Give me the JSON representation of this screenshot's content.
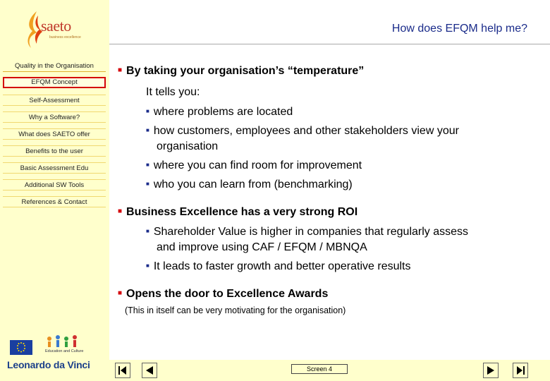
{
  "header": {
    "logo_text": "saeto",
    "logo_sub": "business excellence",
    "title": "How does EFQM help me?"
  },
  "sidebar": {
    "items": [
      {
        "label": "Quality in the Organisation"
      },
      {
        "label": "EFQM Concept"
      },
      {
        "label": "Self-Assessment"
      },
      {
        "label": "Why a Software?"
      },
      {
        "label": "What does SAETO offer"
      },
      {
        "label": "Benefits to the user"
      },
      {
        "label": "Basic Assessment Edu"
      },
      {
        "label": "Additional SW Tools"
      },
      {
        "label": "References & Contact"
      }
    ],
    "edu_logo_text": "Education and Culture",
    "leonardo_text": "Leonardo da Vinci"
  },
  "content": {
    "b1_title": "By taking your organisation’s “temperature”",
    "b1_intro": "It tells you:",
    "b1_items": [
      "where problems are located",
      "how customers, employees and other stakeholders view your",
      "organisation",
      "where you can find room for improvement",
      "who you can learn from (benchmarking)"
    ],
    "b2_title": "Business Excellence has a very strong ROI",
    "b2_items": [
      "Shareholder Value is higher in companies that regularly assess",
      "and improve using CAF / EFQM / MBNQA",
      "It leads to faster growth and better operative results"
    ],
    "b3_title": "Opens the door to Excellence Awards",
    "b3_note": "(This in itself can be very motivating for the organisation)"
  },
  "footer": {
    "screen_label": "Screen 4"
  },
  "colors": {
    "sidebar_bg": "#ffffcc",
    "title": "#1a2b8a",
    "bullet_red": "#d4000a",
    "active_border": "#d4000a"
  }
}
